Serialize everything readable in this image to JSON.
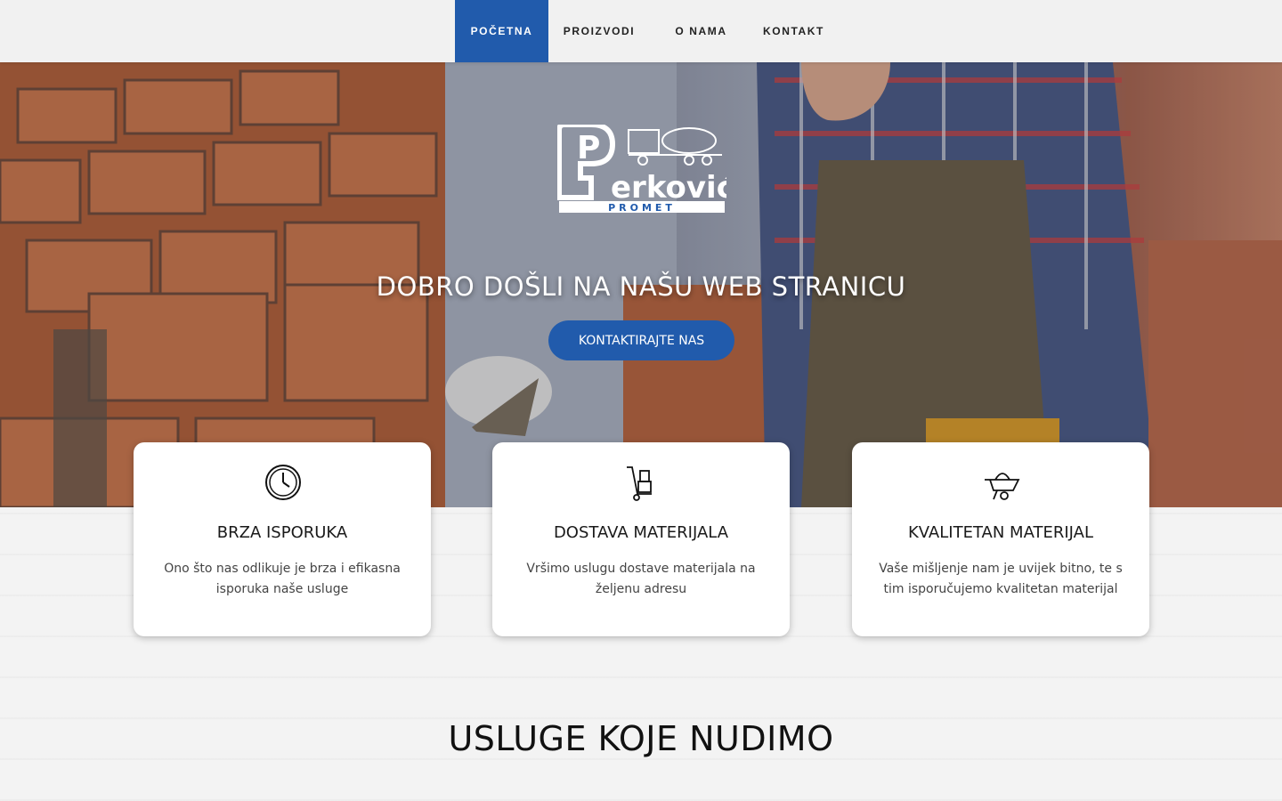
{
  "nav": {
    "items": [
      {
        "label": "POČETNA",
        "active": true
      },
      {
        "label": "PROIZVODI",
        "active": false
      },
      {
        "label": "O NAMA",
        "active": false
      },
      {
        "label": "KONTAKT",
        "active": false
      }
    ]
  },
  "hero": {
    "logo_text": "erković",
    "logo_initial": "P",
    "logo_subtitle": "PROMET",
    "title": "DOBRO DOŠLI NA NAŠU WEB STRANICU",
    "cta_label": "KONTAKTIRAJTE NAS"
  },
  "features": [
    {
      "icon": "clock-icon",
      "title": "BRZA ISPORUKA",
      "text": "Ono što nas odlikuje je brza i efikasna isporuka naše usluge"
    },
    {
      "icon": "hand-truck-icon",
      "title": "DOSTAVA MATERIJALA",
      "text": "Vršimo uslugu dostave materijala na željenu adresu"
    },
    {
      "icon": "wheelbarrow-icon",
      "title": "KVALITETAN MATERIJAL",
      "text": "Vaše mišljenje nam je uvijek bitno, te s tim isporučujemo kvalitetan materijal"
    }
  ],
  "services": {
    "title": "USLUGE KOJE NUDIMO"
  },
  "colors": {
    "accent": "#215bac",
    "nav_bg": "#f1f1f1"
  }
}
